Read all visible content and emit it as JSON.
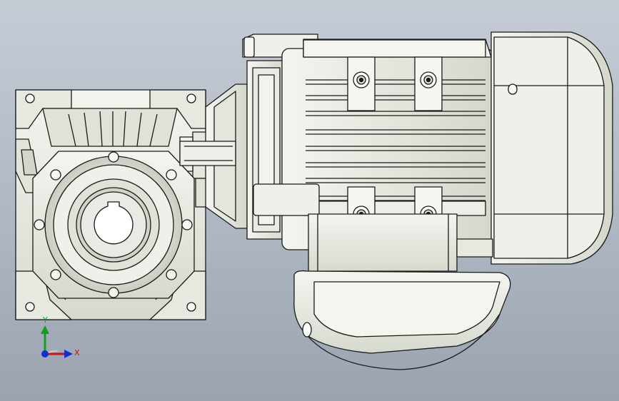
{
  "app": {
    "view_name": "cad-3d-viewport",
    "model": "worm-gear-motor"
  },
  "colors": {
    "background_top": "#c6ccd5",
    "background_bottom": "#9aa3af",
    "part_fill": "#ecefe6",
    "part_shade": "#d9ddd0",
    "edge": "#1a1a1a",
    "axis_x": "#d01010",
    "axis_y": "#10a020",
    "axis_z": "#1030d0"
  },
  "triad": {
    "x_label": "X",
    "y_label": "Y"
  },
  "icons": [
    "coordinate-triad-icon"
  ]
}
